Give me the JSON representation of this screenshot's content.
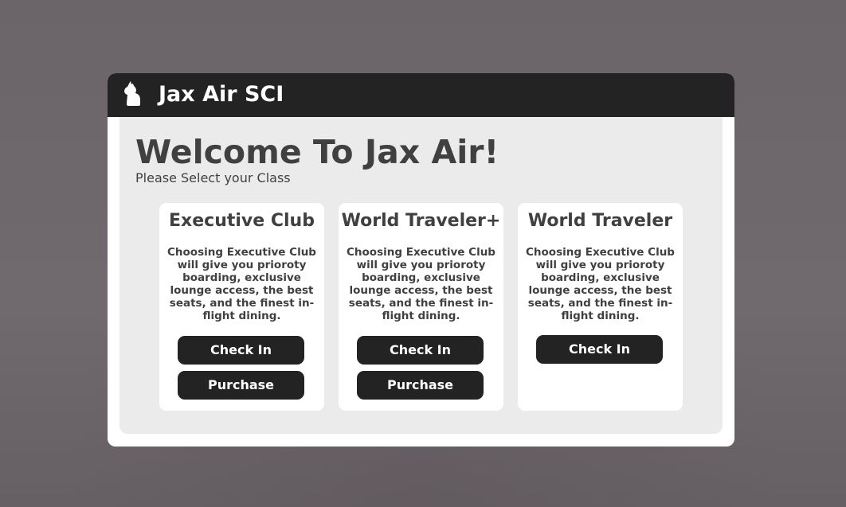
{
  "app": {
    "title": "Jax Air SCI",
    "logo_icon": "llama-logo-icon"
  },
  "main": {
    "heading": "Welcome To Jax Air!",
    "subheading": "Please Select your Class"
  },
  "classes": [
    {
      "name": "Executive Club",
      "description": "Choosing Executive Club will give you prioroty boarding, exclusive lounge access, the best seats, and the finest in-flight dining.",
      "check_in_label": "Check In",
      "purchase_label": "Purchase"
    },
    {
      "name": "World Traveler+",
      "description": "Choosing Executive Club will give you prioroty boarding, exclusive lounge access, the best seats, and the finest in-flight dining.",
      "check_in_label": "Check In",
      "purchase_label": "Purchase"
    },
    {
      "name": "World Traveler",
      "description": "Choosing Executive Club will give you prioroty boarding, exclusive lounge access, the best seats, and the finest in-flight dining.",
      "check_in_label": "Check In"
    }
  ],
  "colors": {
    "backdrop": "#6e686c",
    "titlebar": "#232323",
    "panel": "#ebebeb",
    "text": "#404040",
    "button": "#232323"
  }
}
